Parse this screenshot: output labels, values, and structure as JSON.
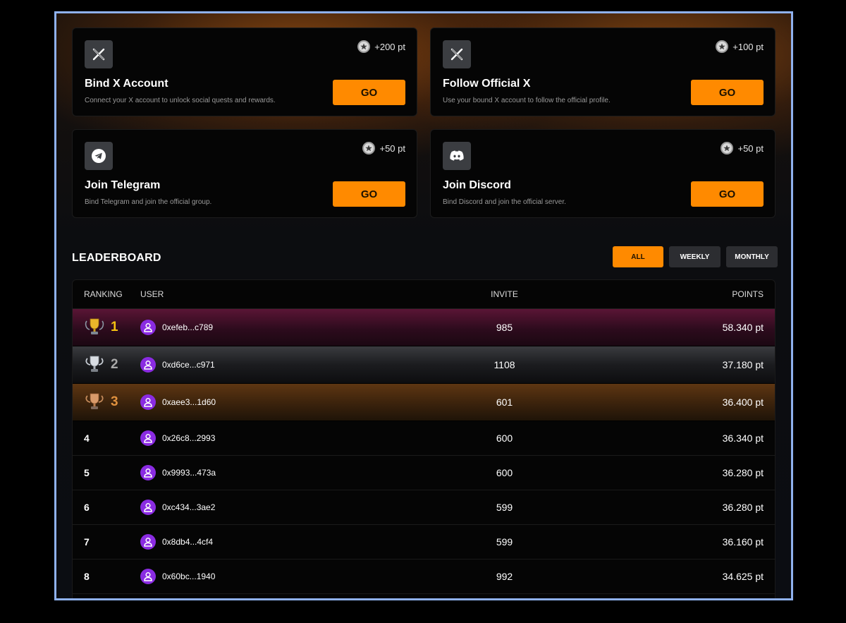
{
  "quests": [
    {
      "icon": "x-logo-icon",
      "reward": "+200 pt",
      "title": "Bind X Account",
      "desc": "Connect your X account to unlock social quests and rewards.",
      "button": "GO"
    },
    {
      "icon": "x-logo-icon",
      "reward": "+100 pt",
      "title": "Follow Official X",
      "desc": "Use your bound X account to follow the official profile.",
      "button": "GO"
    },
    {
      "icon": "telegram-icon",
      "reward": "+50 pt",
      "title": "Join Telegram",
      "desc": "Bind Telegram and join the official group.",
      "button": "GO"
    },
    {
      "icon": "discord-icon",
      "reward": "+50 pt",
      "title": "Join Discord",
      "desc": "Bind Discord and join the official server.",
      "button": "GO"
    }
  ],
  "leaderboard": {
    "title": "LEADERBOARD",
    "filters": [
      "ALL",
      "WEEKLY",
      "MONTHLY"
    ],
    "active_filter": "ALL",
    "columns": {
      "ranking": "RANKING",
      "user": "USER",
      "invite": "INVITE",
      "points": "POINTS"
    },
    "rows": [
      {
        "rank": "1",
        "user": "0xefeb...c789",
        "invite": "985",
        "points": "58.340 pt"
      },
      {
        "rank": "2",
        "user": "0xd6ce...c971",
        "invite": "1108",
        "points": "37.180 pt"
      },
      {
        "rank": "3",
        "user": "0xaee3...1d60",
        "invite": "601",
        "points": "36.400 pt"
      },
      {
        "rank": "4",
        "user": "0x26c8...2993",
        "invite": "600",
        "points": "36.340 pt"
      },
      {
        "rank": "5",
        "user": "0x9993...473a",
        "invite": "600",
        "points": "36.280 pt"
      },
      {
        "rank": "6",
        "user": "0xc434...3ae2",
        "invite": "599",
        "points": "36.280 pt"
      },
      {
        "rank": "7",
        "user": "0x8db4...4cf4",
        "invite": "599",
        "points": "36.160 pt"
      },
      {
        "rank": "8",
        "user": "0x60bc...1940",
        "invite": "992",
        "points": "34.625 pt"
      }
    ]
  },
  "colors": {
    "accent": "#ff8a00",
    "avatar": "#8a2be2",
    "rank1": "#f5c211",
    "rank2": "#a9a9a9",
    "rank3": "#e0913e"
  }
}
